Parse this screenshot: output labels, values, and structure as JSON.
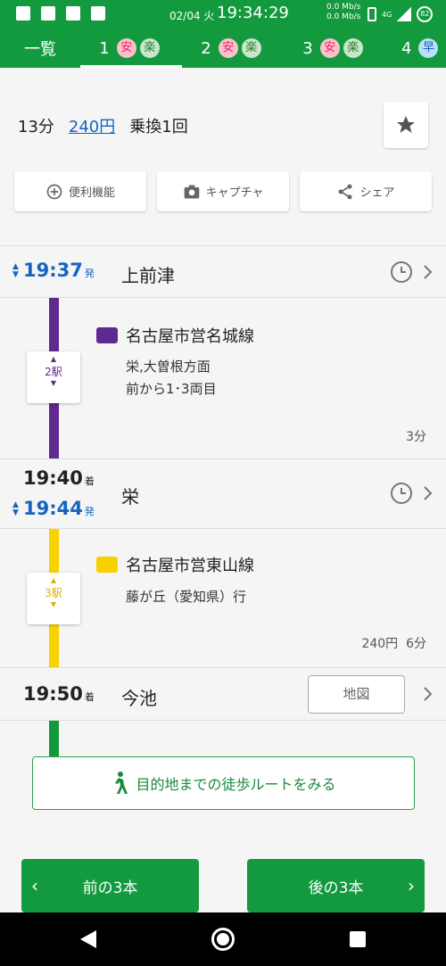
{
  "status_bar": {
    "date": "02/04 火",
    "time": "19:34:29",
    "net_up": "0.0 Mb/s",
    "net_down": "0.0 Mb/s",
    "network": "4G",
    "battery": "82"
  },
  "tabs": [
    {
      "label": "一覧"
    },
    {
      "num": "1",
      "badges": [
        "安",
        "楽"
      ]
    },
    {
      "num": "2",
      "badges": [
        "安",
        "楽"
      ]
    },
    {
      "num": "3",
      "badges": [
        "安",
        "楽"
      ]
    },
    {
      "num": "4",
      "badges": [
        "早"
      ]
    }
  ],
  "summary": {
    "duration": "13分",
    "fare": "240円",
    "transfers": "乗換1回"
  },
  "actions": {
    "features": "便利機能",
    "capture": "キャプチャ",
    "share": "シェア"
  },
  "route": {
    "stations": [
      {
        "dep_time": "19:37",
        "dep_suffix": "発",
        "name": "上前津"
      },
      {
        "arr_time": "19:40",
        "arr_suffix": "着",
        "dep_time": "19:44",
        "dep_suffix": "発",
        "name": "栄"
      },
      {
        "arr_time": "19:50",
        "arr_suffix": "着",
        "name": "今池"
      }
    ],
    "segments": [
      {
        "stops": "2駅",
        "line": "名古屋市営名城線",
        "direction": "栄,大曽根方面",
        "car": "前から1･3両目",
        "duration": "3分",
        "color": "#5e2a8f"
      },
      {
        "stops": "3駅",
        "line": "名古屋市営東山線",
        "direction": "藤が丘（愛知県）行",
        "fare": "240円",
        "duration": "6分",
        "color": "#f7d100"
      }
    ],
    "walk_color": "#149a3e",
    "map_button": "地図",
    "walk_button": "目的地までの徒歩ルートをみる"
  },
  "nav": {
    "prev": "前の3本",
    "next": "後の3本"
  },
  "colors": {
    "brand": "#149a3e",
    "link": "#1565c0"
  }
}
